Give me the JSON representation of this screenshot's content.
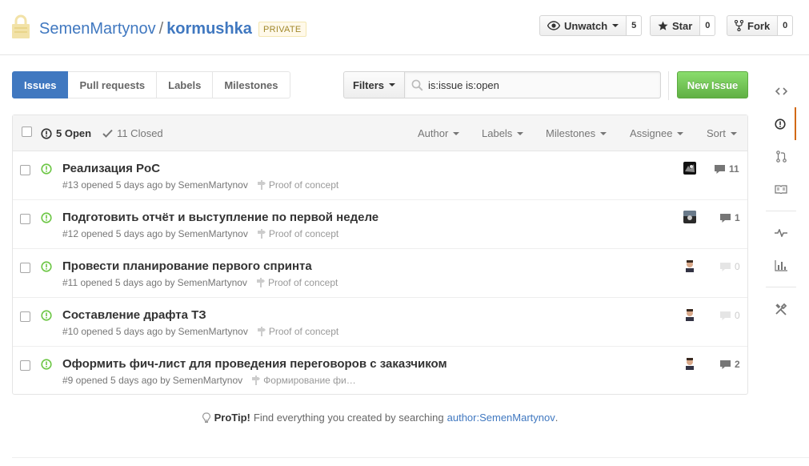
{
  "repo": {
    "owner": "SemenMartynov",
    "separator": "/",
    "name": "kormushka",
    "visibility": "PRIVATE"
  },
  "actions": {
    "watch_label": "Unwatch",
    "watch_count": "5",
    "star_label": "Star",
    "star_count": "0",
    "fork_label": "Fork",
    "fork_count": "0"
  },
  "subnav": {
    "issues": "Issues",
    "pulls": "Pull requests",
    "labels": "Labels",
    "milestones": "Milestones"
  },
  "filters": {
    "label": "Filters",
    "query": "is:issue is:open",
    "new_issue": "New Issue"
  },
  "table_header": {
    "open_label": "5 Open",
    "closed_label": "11 Closed",
    "author": "Author",
    "labels": "Labels",
    "milestones": "Milestones",
    "assignee": "Assignee",
    "sort": "Sort"
  },
  "issues": [
    {
      "title": "Реализация PoC",
      "meta": "#13 opened 5 days ago by",
      "author": "SemenMartynov",
      "milestone": "Proof of concept",
      "comments": "11"
    },
    {
      "title": "Подготовить отчёт и выступление по первой неделе",
      "meta": "#12 opened 5 days ago by",
      "author": "SemenMartynov",
      "milestone": "Proof of concept",
      "comments": "1"
    },
    {
      "title": "Провести планирование первого спринта",
      "meta": "#11 opened 5 days ago by",
      "author": "SemenMartynov",
      "milestone": "Proof of concept",
      "comments": "0"
    },
    {
      "title": "Составление драфта ТЗ",
      "meta": "#10 opened 5 days ago by",
      "author": "SemenMartynov",
      "milestone": "Proof of concept",
      "comments": "0"
    },
    {
      "title": "Оформить фич-лист для проведения переговоров с заказчиком",
      "meta": "#9 opened 5 days ago by",
      "author": "SemenMartynov",
      "milestone": "Формирование фи…",
      "comments": "2"
    }
  ],
  "protip": {
    "label": "ProTip!",
    "text": "Find everything you created by searching",
    "link": "author:SemenMartynov",
    "end": "."
  },
  "colors": {
    "accent": "#4078c0",
    "open_green": "#6cc644",
    "new_issue_green": "#60b044",
    "selected_side": "#d26911"
  }
}
